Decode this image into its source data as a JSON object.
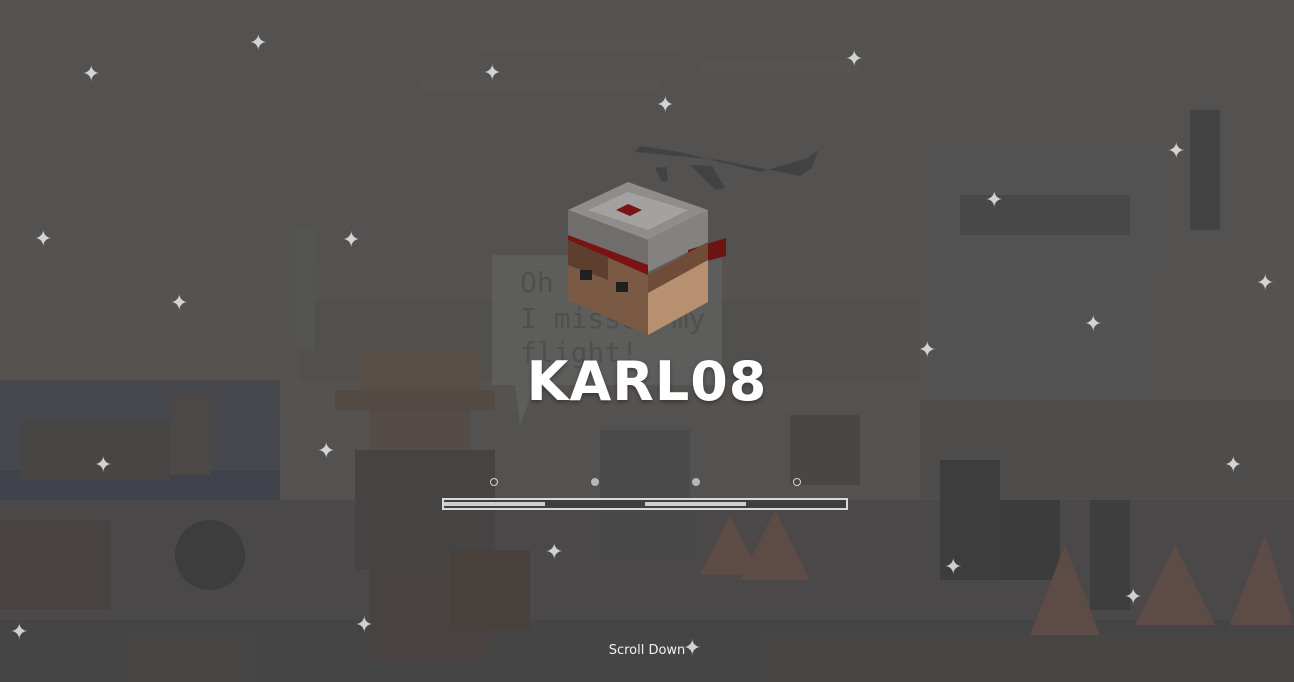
{
  "hero": {
    "player_name": "KARL08",
    "speech_bubble_lines": [
      "Oh",
      "I missed my",
      "flight!"
    ]
  },
  "carousel": {
    "slides": 4,
    "active_slide": 2,
    "progress_fraction": 0.5
  },
  "footer": {
    "scroll_label": "Scroll Down"
  },
  "colors": {
    "overlay": "#555454",
    "text": "#ffffff",
    "progress_border": "#d9d9d9",
    "progress_fill": "#cfcfcf",
    "progress_track": "#3f3f3f",
    "cap_red": "#7a1414"
  },
  "icons": {
    "sparkle": "sparkle-icon",
    "airplane": "airplane-icon"
  }
}
